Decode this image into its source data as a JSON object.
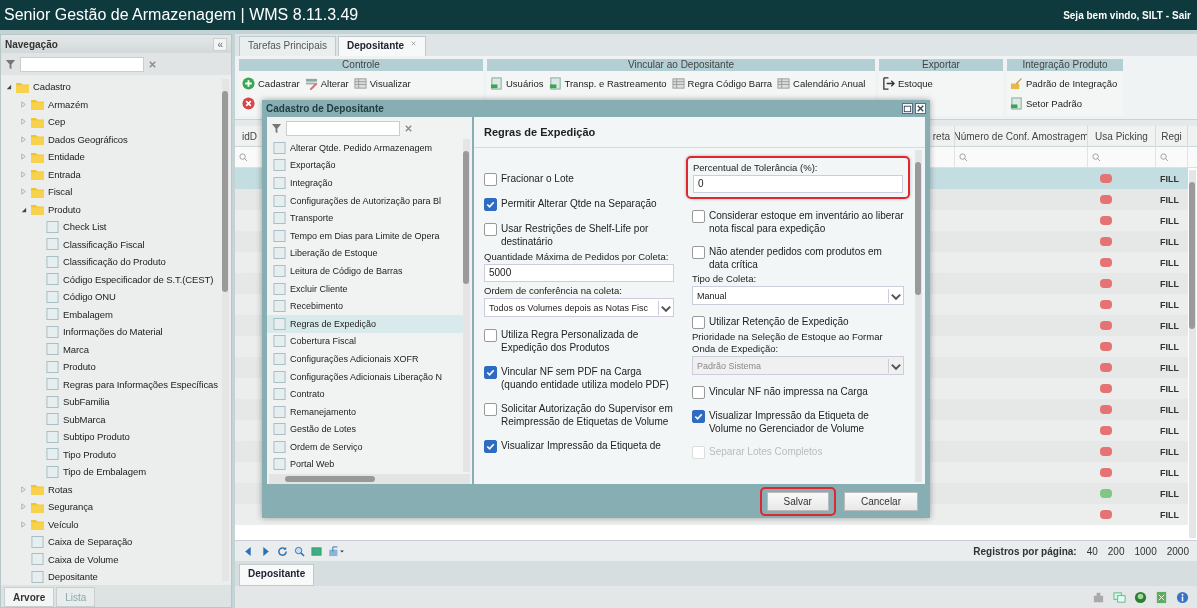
{
  "window": {
    "title": "Senior Gestão de Armazenagem | WMS 8.11.3.49",
    "greeting": "Seja bem vindo, SILT -",
    "logout": "Sair"
  },
  "navigation": {
    "title": "Navegação",
    "collapse": "«",
    "tree": [
      {
        "kind": "folder",
        "label": "Cadastro",
        "expanded": true,
        "children": [
          {
            "kind": "folder",
            "label": "Armazém",
            "expanded": false
          },
          {
            "kind": "folder",
            "label": "Cep",
            "expanded": false
          },
          {
            "kind": "folder",
            "label": "Dados Geográficos",
            "expanded": false
          },
          {
            "kind": "folder",
            "label": "Entidade",
            "expanded": false
          },
          {
            "kind": "folder",
            "label": "Entrada",
            "expanded": false
          },
          {
            "kind": "folder",
            "label": "Fiscal",
            "expanded": false
          },
          {
            "kind": "folder",
            "label": "Produto",
            "expanded": true,
            "children": [
              {
                "kind": "leaf",
                "label": "Check List"
              },
              {
                "kind": "leaf",
                "label": "Classificação Fiscal"
              },
              {
                "kind": "leaf",
                "label": "Classificação do Produto"
              },
              {
                "kind": "leaf",
                "label": "Código Especificador de S.T.(CEST)"
              },
              {
                "kind": "leaf",
                "label": "Código ONU"
              },
              {
                "kind": "leaf",
                "label": "Embalagem"
              },
              {
                "kind": "leaf",
                "label": "Informações do Material"
              },
              {
                "kind": "leaf",
                "label": "Marca"
              },
              {
                "kind": "leaf",
                "label": "Produto"
              },
              {
                "kind": "leaf",
                "label": "Regras para Informações Específicas"
              },
              {
                "kind": "leaf",
                "label": "SubFamilia"
              },
              {
                "kind": "leaf",
                "label": "SubMarca"
              },
              {
                "kind": "leaf",
                "label": "Subtipo Produto"
              },
              {
                "kind": "leaf",
                "label": "Tipo Produto"
              },
              {
                "kind": "leaf",
                "label": "Tipo de Embalagem"
              }
            ]
          },
          {
            "kind": "folder",
            "label": "Rotas",
            "expanded": false
          },
          {
            "kind": "folder",
            "label": "Segurança",
            "expanded": false
          },
          {
            "kind": "folder",
            "label": "Veículo",
            "expanded": false
          },
          {
            "kind": "leaf",
            "label": "Caixa de Separação"
          },
          {
            "kind": "leaf",
            "label": "Caixa de Volume"
          },
          {
            "kind": "leaf",
            "label": "Depositante"
          }
        ]
      }
    ],
    "bottom_tabs": [
      {
        "label": "Arvore",
        "selected": true
      },
      {
        "label": "Lista",
        "selected": false
      }
    ]
  },
  "tabs": [
    {
      "label": "Tarefas Principais",
      "selected": false,
      "closable": false
    },
    {
      "label": "Depositante",
      "selected": true,
      "closable": true
    }
  ],
  "ribbon": [
    {
      "title": "Controle",
      "rows": [
        [
          {
            "label": "Cadastrar"
          },
          {
            "label": "Alterar"
          },
          {
            "label": "Visualizar"
          }
        ]
      ]
    },
    {
      "title": "Vincular ao Depositante",
      "rows": [
        [
          {
            "label": "Usuários"
          },
          {
            "label": "Transp. e Rastreamento"
          },
          {
            "label": "Regra Código Barra"
          },
          {
            "label": "Calendário Anual"
          }
        ]
      ]
    },
    {
      "title": "Exportar",
      "rows": [
        [
          {
            "label": "Estoque"
          }
        ]
      ]
    },
    {
      "title": "Integração Produto",
      "rows": [
        [
          {
            "label": "Padrão de Integração"
          }
        ],
        [
          {
            "label": "Setor Padrão"
          }
        ]
      ]
    }
  ],
  "grid": {
    "columns": [
      {
        "label": "idD"
      },
      {
        "label": "reta"
      },
      {
        "label": "Número de Conf. Amostragem"
      },
      {
        "label": "Usa Picking"
      },
      {
        "label": "Regi"
      }
    ],
    "rows": [
      {
        "selected": true,
        "color": "#e57373",
        "column_5": "FILL"
      },
      {
        "selected": false,
        "color": "#e57373",
        "column_5": "FILL"
      },
      {
        "selected": false,
        "color": "#e57373",
        "column_5": "FILL"
      },
      {
        "selected": false,
        "color": "#e57373",
        "column_5": "FILL"
      },
      {
        "selected": false,
        "color": "#e57373",
        "column_5": "FILL"
      },
      {
        "selected": false,
        "color": "#e57373",
        "column_5": "FILL"
      },
      {
        "selected": false,
        "color": "#e57373",
        "column_5": "FILL"
      },
      {
        "selected": false,
        "color": "#e57373",
        "column_5": "FILL"
      },
      {
        "selected": false,
        "color": "#e57373",
        "column_5": "FILL"
      },
      {
        "selected": false,
        "color": "#e57373",
        "column_5": "FILL"
      },
      {
        "selected": false,
        "color": "#e57373",
        "column_5": "FILL"
      },
      {
        "selected": false,
        "color": "#e57373",
        "column_5": "FILL"
      },
      {
        "selected": false,
        "color": "#e57373",
        "column_5": "FILL"
      },
      {
        "selected": false,
        "color": "#e57373",
        "column_5": "FILL"
      },
      {
        "selected": false,
        "color": "#e57373",
        "column_5": "FILL"
      },
      {
        "selected": false,
        "color": "#81c784",
        "column_5": "FILL"
      },
      {
        "selected": false,
        "color": "#e57373",
        "column_5": "FILL"
      }
    ],
    "pager": {
      "label": "Registros por página:",
      "sizes": [
        "40",
        "200",
        "1000",
        "2000"
      ]
    }
  },
  "bottom_tabs": [
    {
      "label": "Depositante",
      "selected": true
    }
  ],
  "dialog": {
    "title": "Cadastro de Depositante",
    "sections": [
      {
        "label": "Alterar Qtde. Pedido Armazenagem",
        "selected": false
      },
      {
        "label": "Exportação",
        "selected": false
      },
      {
        "label": "Integração",
        "selected": false
      },
      {
        "label": "Configurações de Autorização para Bl",
        "selected": false
      },
      {
        "label": "Transporte",
        "selected": false
      },
      {
        "label": "Tempo em Dias para Limite de Opera",
        "selected": false
      },
      {
        "label": "Liberação de Estoque",
        "selected": false
      },
      {
        "label": "Leitura de Código de Barras",
        "selected": false
      },
      {
        "label": "Excluir Cliente",
        "selected": false
      },
      {
        "label": "Recebimento",
        "selected": false
      },
      {
        "label": "Regras de Expedição",
        "selected": true
      },
      {
        "label": "Cobertura Fiscal",
        "selected": false
      },
      {
        "label": "Configurações Adicionais XOFR",
        "selected": false
      },
      {
        "label": "Configurações Adicionais Liberação N",
        "selected": false
      },
      {
        "label": "Contrato",
        "selected": false
      },
      {
        "label": "Remanejamento",
        "selected": false
      },
      {
        "label": "Gestão de Lotes",
        "selected": false
      },
      {
        "label": "Ordem de Serviço",
        "selected": false
      },
      {
        "label": "Portal Web",
        "selected": false
      }
    ],
    "heading": "Regras de Expedição",
    "columns": [
      [
        {
          "kind": "checkbox",
          "label": "Fracionar o Lote",
          "checked": false,
          "disabled": false
        },
        {
          "kind": "checkbox",
          "label": "Permitir Alterar Qtde na Separação",
          "checked": true,
          "disabled": false
        },
        {
          "kind": "checkbox",
          "label": "Usar Restrições de Shelf-Life por destinatário",
          "checked": false,
          "disabled": false
        },
        {
          "kind": "text",
          "label": "Quantidade Máxima de Pedidos por Coleta:",
          "value": "5000",
          "highlighted": false
        },
        {
          "kind": "select",
          "label": "Ordem de conferência na coleta:",
          "value": "Todos os Volumes depois as Notas Fisc",
          "disabled": false
        },
        {
          "kind": "checkbox",
          "label": "Utiliza Regra Personalizada de Expedição dos Produtos",
          "checked": false,
          "disabled": false
        },
        {
          "kind": "checkbox",
          "label": "Vincular NF sem PDF na Carga (quando entidade utiliza modelo PDF)",
          "checked": true,
          "disabled": false
        },
        {
          "kind": "checkbox",
          "label": "Solicitar Autorização do Supervisor em Reimpressão de Etiquetas de Volume",
          "checked": false,
          "disabled": false
        },
        {
          "kind": "checkbox",
          "label": "Visualizar Impressão da Etiqueta de",
          "checked": true,
          "disabled": false
        }
      ],
      [
        {
          "kind": "text",
          "label": "Percentual de Tolerância (%):",
          "value": "0",
          "highlighted": true
        },
        {
          "kind": "checkbox",
          "label": "Considerar estoque em inventário ao liberar nota fiscal para expedição",
          "checked": false,
          "disabled": false
        },
        {
          "kind": "checkbox",
          "label": "Não atender pedidos com produtos em data crítica",
          "checked": false,
          "disabled": false
        },
        {
          "kind": "select",
          "label": "Tipo de Coleta:",
          "value": "Manual",
          "disabled": false
        },
        {
          "kind": "checkbox",
          "label": "Utilizar Retenção de Expedição",
          "checked": false,
          "disabled": false
        },
        {
          "kind": "select",
          "label": "Prioridade na Seleção de Estoque ao Formar Onda de Expedição:",
          "value": "Padrão Sistema",
          "disabled": true
        },
        {
          "kind": "checkbox",
          "label": "Vincular NF não impressa na Carga",
          "checked": false,
          "disabled": false
        },
        {
          "kind": "checkbox",
          "label": "Visualizar Impressão da Etiqueta de Volume no Gerenciador de Volume",
          "checked": true,
          "disabled": false
        },
        {
          "kind": "checkbox",
          "label": "Separar Lotes Completos",
          "checked": false,
          "disabled": true
        }
      ]
    ],
    "buttons": [
      {
        "label": "Salvar",
        "highlighted": true
      },
      {
        "label": "Cancelar",
        "highlighted": false
      }
    ]
  }
}
